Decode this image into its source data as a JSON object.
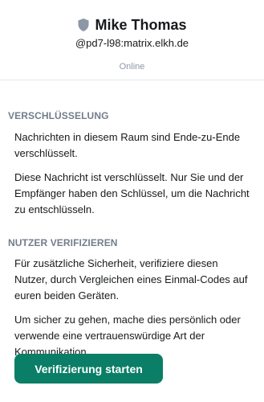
{
  "header": {
    "display_name": "Mike Thomas",
    "user_id": "@pd7-l98:matrix.elkh.de",
    "presence": "Online",
    "shield_icon": "shield-icon",
    "shield_color": "#8d97a5"
  },
  "encryption": {
    "title": "VERSCHLÜSSELUNG",
    "paragraphs": [
      "Nachrichten in diesem Raum sind Ende-zu-Ende verschlüsselt.",
      "Diese Nachricht ist verschlüsselt. Nur Sie und der Empfänger haben den Schlüssel, um die Nachricht zu entschlüsseln."
    ]
  },
  "verification": {
    "title": "NUTZER VERIFIZIEREN",
    "paragraphs": [
      "Für zusätzliche Sicherheit, verifiziere diesen Nutzer, durch Vergleichen eines Einmal-Codes auf euren beiden Geräten.",
      "Um sicher zu gehen, mache dies persönlich oder verwende eine vertrauenswürdige Art der Kommunikation."
    ],
    "button_label": "Verifizierung starten",
    "button_color": "#0a7e66"
  }
}
